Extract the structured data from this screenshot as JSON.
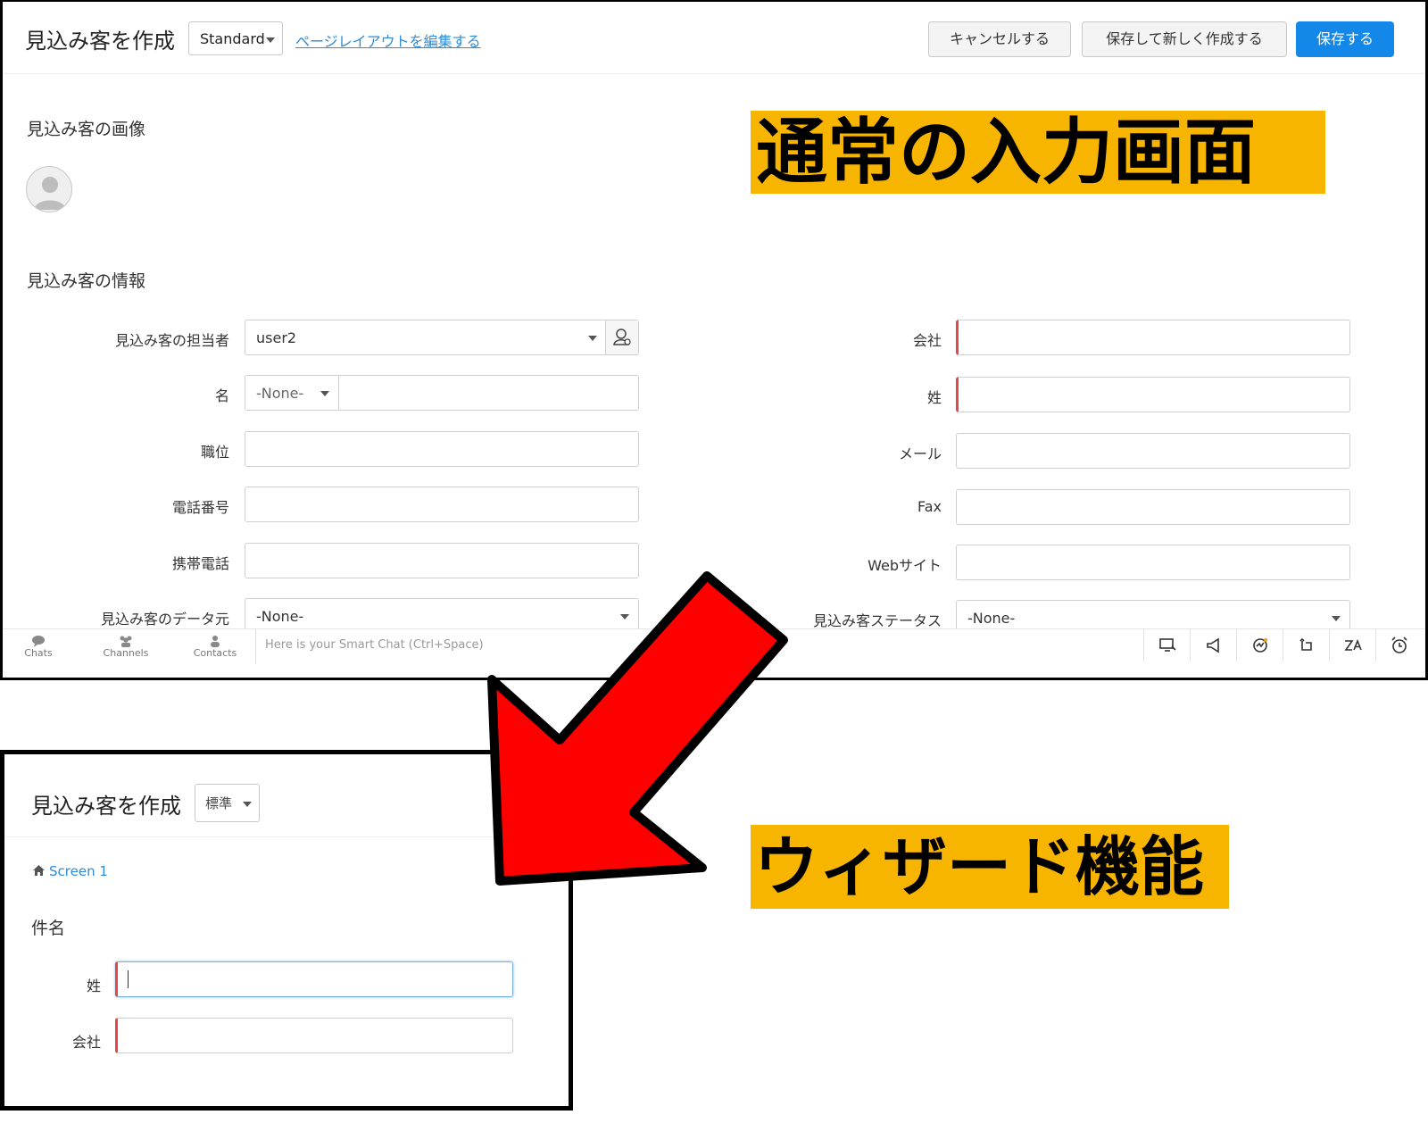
{
  "standard": {
    "title": "見込み客を作成",
    "layout_select": "Standard",
    "edit_layout_link": "ページレイアウトを編集する",
    "buttons": {
      "cancel": "キャンセルする",
      "save_and_new": "保存して新しく作成する",
      "save": "保存する"
    },
    "image_section": "見込み客の画像",
    "info_section": "見込み客の情報",
    "left_fields": [
      {
        "label": "見込み客の担当者",
        "value": "user2"
      },
      {
        "label": "名",
        "value": "-None-"
      },
      {
        "label": "職位",
        "value": ""
      },
      {
        "label": "電話番号",
        "value": ""
      },
      {
        "label": "携帯電話",
        "value": ""
      },
      {
        "label": "見込み客のデータ元",
        "value": "-None-"
      }
    ],
    "right_fields": [
      {
        "label": "会社",
        "value": ""
      },
      {
        "label": "姓",
        "value": ""
      },
      {
        "label": "メール",
        "value": ""
      },
      {
        "label": "Fax",
        "value": ""
      },
      {
        "label": "Webサイト",
        "value": ""
      },
      {
        "label": "見込み客ステータス",
        "value": "-None-"
      }
    ],
    "bottom_bar": {
      "chats": "Chats",
      "channels": "Channels",
      "contacts": "Contacts",
      "smart_chat_placeholder": "Here is your Smart Chat (Ctrl+Space)"
    }
  },
  "banner_normal": "通常の入力画面",
  "banner_wizard": "ウィザード機能",
  "wizard": {
    "title": "見込み客を作成",
    "layout_select": "標準",
    "breadcrumb": "Screen 1",
    "section": "件名",
    "fields": [
      {
        "label": "姓",
        "value": ""
      },
      {
        "label": "会社",
        "value": ""
      }
    ]
  },
  "colors": {
    "primary_button": "#1488e8",
    "banner": "#f7b500",
    "arrow": "#ff0000",
    "required_marker": "#e34747",
    "link": "#2d8cd8"
  }
}
